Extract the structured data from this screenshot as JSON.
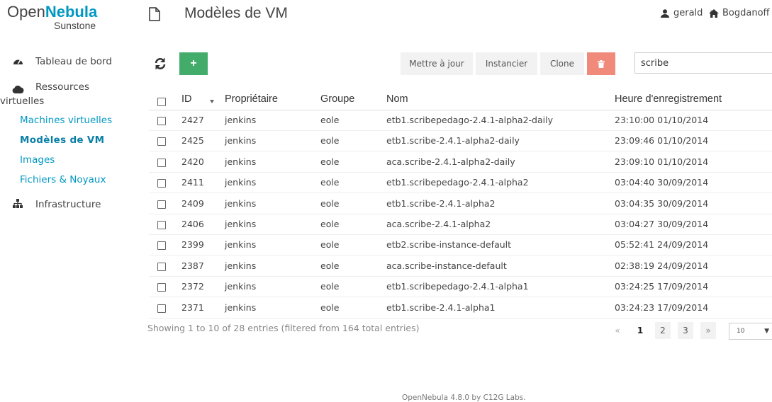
{
  "logo": {
    "part1": "Open",
    "part2": "Nebula",
    "sub": "Sunstone"
  },
  "sidebar": {
    "dashboard": "Tableau de bord",
    "virtual_resources": {
      "line1": "Ressources",
      "line2": "virtuelles"
    },
    "sub_items": [
      "Machines virtuelles",
      "Modèles de VM",
      "Images",
      "Fichiers & Noyaux"
    ],
    "active_item": "Modèles de VM",
    "infrastructure": "Infrastructure"
  },
  "header": {
    "title": "Modèles de VM",
    "user": "gerald",
    "zone": "Bogdanoff"
  },
  "toolbar": {
    "add_label": "+",
    "update_label": "Mettre à jour",
    "instantiate_label": "Instancier",
    "clone_label": "Clone",
    "search_value": "scribe"
  },
  "table": {
    "columns": [
      "ID",
      "Propriétaire",
      "Groupe",
      "Nom",
      "Heure d'enregistrement"
    ],
    "rows": [
      {
        "id": "2427",
        "owner": "jenkins",
        "group": "eole",
        "name": "etb1.scribepedago-2.4.1-alpha2-daily",
        "time": "23:10:00 01/10/2014"
      },
      {
        "id": "2425",
        "owner": "jenkins",
        "group": "eole",
        "name": "etb1.scribe-2.4.1-alpha2-daily",
        "time": "23:09:46 01/10/2014"
      },
      {
        "id": "2420",
        "owner": "jenkins",
        "group": "eole",
        "name": "aca.scribe-2.4.1-alpha2-daily",
        "time": "23:09:10 01/10/2014"
      },
      {
        "id": "2411",
        "owner": "jenkins",
        "group": "eole",
        "name": "etb1.scribepedago-2.4.1-alpha2",
        "time": "03:04:40 30/09/2014"
      },
      {
        "id": "2409",
        "owner": "jenkins",
        "group": "eole",
        "name": "etb1.scribe-2.4.1-alpha2",
        "time": "03:04:35 30/09/2014"
      },
      {
        "id": "2406",
        "owner": "jenkins",
        "group": "eole",
        "name": "aca.scribe-2.4.1-alpha2",
        "time": "03:04:27 30/09/2014"
      },
      {
        "id": "2399",
        "owner": "jenkins",
        "group": "eole",
        "name": "etb2.scribe-instance-default",
        "time": "05:52:41 24/09/2014"
      },
      {
        "id": "2387",
        "owner": "jenkins",
        "group": "eole",
        "name": "aca.scribe-instance-default",
        "time": "02:38:19 24/09/2014"
      },
      {
        "id": "2372",
        "owner": "jenkins",
        "group": "eole",
        "name": "etb1.scribepedago-2.4.1-alpha1",
        "time": "03:24:25 17/09/2014"
      },
      {
        "id": "2371",
        "owner": "jenkins",
        "group": "eole",
        "name": "etb1.scribe-2.4.1-alpha1",
        "time": "03:24:23 17/09/2014"
      }
    ]
  },
  "pagination": {
    "info": "Showing 1 to 10 of 28 entries (filtered from 164 total entries)",
    "prev": "«",
    "pages": [
      "1",
      "2",
      "3"
    ],
    "current": "1",
    "next": "»",
    "per_page": "10"
  },
  "footer": "OpenNebula 4.8.0 by C12G Labs.",
  "colors": {
    "brand": "#0098c3",
    "add_button": "#43ac6a",
    "delete_button": "#f08a7b"
  }
}
